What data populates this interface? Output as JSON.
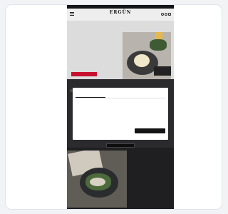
{
  "status_bar": {
    "left": "",
    "right": ""
  },
  "header": {
    "logo": "ERGÜN",
    "tagline": "",
    "icons": [
      "menu-icon",
      "search-icon",
      "account-icon",
      "cart-icon"
    ]
  },
  "hero": {
    "kicker": "",
    "title": "",
    "body": "",
    "cta_label": "",
    "badge": ""
  },
  "cookie_dialog": {
    "logo": "",
    "tabs": [
      "",
      "",
      ""
    ],
    "active_tab_index": 0,
    "heading": "",
    "text": "",
    "links": "",
    "deny_label": "",
    "accept_label": ""
  },
  "article": {
    "kicker": "",
    "title": "",
    "link": ""
  },
  "colors": {
    "brand_red": "#c8102e",
    "dark_overlay": "#2b2b2d",
    "dialog_bg": "#ffffff",
    "accept_button": "#141414"
  }
}
